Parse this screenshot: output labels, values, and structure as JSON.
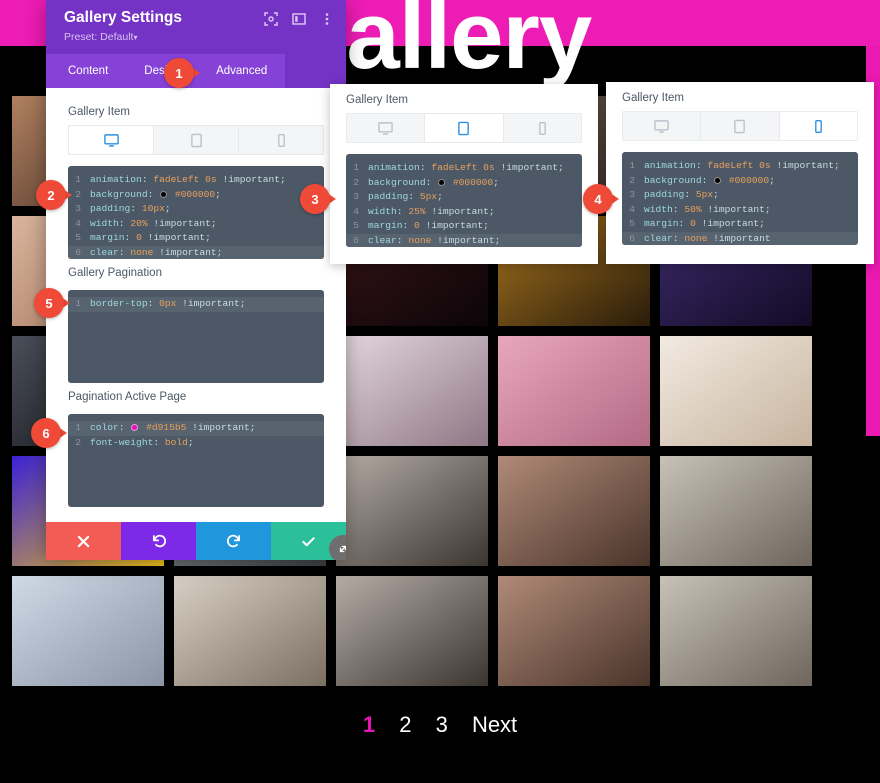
{
  "page": {
    "title": "gallery",
    "header_color": "#ec1cb4",
    "background_color": "#000000",
    "accent_color": "#e614b6"
  },
  "pagination": {
    "pages": [
      "1",
      "2",
      "3"
    ],
    "next_label": "Next",
    "active_page": "1",
    "active_color": "#d915b5"
  },
  "modal": {
    "title": "Gallery Settings",
    "preset_label": "Preset: Default",
    "preset_caret": "▾",
    "header_color": "#7433c5",
    "icons": {
      "focus": "focus-icon",
      "layout": "layout-icon",
      "more": "more-vertical-icon"
    },
    "tabs": [
      {
        "label": "Content",
        "active": false
      },
      {
        "label": "Design",
        "active": false
      },
      {
        "label": "Advanced",
        "active": true
      }
    ],
    "actions": {
      "cancel": "cancel-x",
      "undo": "undo-arrow",
      "redo": "redo-arrow",
      "save": "save-check",
      "cancel_color": "#f25c54",
      "undo_color": "#7c2ae8",
      "redo_color": "#2096dd",
      "save_color": "#2bbf9a"
    }
  },
  "devices": {
    "desktop": "desktop-icon",
    "tablet": "tablet-icon",
    "phone": "phone-icon"
  },
  "sections": {
    "gallery_item_desktop": {
      "label": "Gallery Item",
      "active_device": "desktop",
      "lines": [
        {
          "n": "1",
          "prop": "animation",
          "val": "fadeLeft 0s",
          "imp": "!important;",
          "hl": false
        },
        {
          "n": "2",
          "prop": "background",
          "val": "#000000",
          "swatch": "#000000",
          "imp": ";",
          "hl": false
        },
        {
          "n": "3",
          "prop": "padding",
          "val": "10px",
          "imp": ";",
          "hl": false
        },
        {
          "n": "4",
          "prop": "width",
          "val": "20%",
          "imp": "!important;",
          "hl": false
        },
        {
          "n": "5",
          "prop": "margin",
          "val": "0",
          "imp": "!important;",
          "hl": false
        },
        {
          "n": "6",
          "prop": "clear",
          "val": "none",
          "imp": "!important;",
          "hl": true
        }
      ]
    },
    "gallery_item_tablet": {
      "label": "Gallery Item",
      "active_device": "tablet",
      "lines": [
        {
          "n": "1",
          "prop": "animation",
          "val": "fadeLeft 0s",
          "imp": "!important;",
          "hl": false
        },
        {
          "n": "2",
          "prop": "background",
          "val": "#000000",
          "swatch": "#000000",
          "imp": ";",
          "hl": false
        },
        {
          "n": "3",
          "prop": "padding",
          "val": "5px",
          "imp": ";",
          "hl": false
        },
        {
          "n": "4",
          "prop": "width",
          "val": "25%",
          "imp": "!important;",
          "hl": false
        },
        {
          "n": "5",
          "prop": "margin",
          "val": "0",
          "imp": "!important;",
          "hl": false
        },
        {
          "n": "6",
          "prop": "clear",
          "val": "none",
          "imp": "!important;",
          "hl": true
        }
      ]
    },
    "gallery_item_phone": {
      "label": "Gallery Item",
      "active_device": "phone",
      "lines": [
        {
          "n": "1",
          "prop": "animation",
          "val": "fadeLeft 0s",
          "imp": "!important;",
          "hl": false
        },
        {
          "n": "2",
          "prop": "background",
          "val": "#000000",
          "swatch": "#000000",
          "imp": ";",
          "hl": false
        },
        {
          "n": "3",
          "prop": "padding",
          "val": "5px",
          "imp": ";",
          "hl": false
        },
        {
          "n": "4",
          "prop": "width",
          "val": "50%",
          "imp": "!important;",
          "hl": false
        },
        {
          "n": "5",
          "prop": "margin",
          "val": "0",
          "imp": "!important;",
          "hl": false
        },
        {
          "n": "6",
          "prop": "clear",
          "val": "none",
          "imp": "!important",
          "hl": true
        }
      ]
    },
    "gallery_pagination": {
      "label": "Gallery Pagination",
      "lines": [
        {
          "n": "1",
          "prop": "border-top",
          "val": "0px",
          "imp": "!important;",
          "hl": true
        }
      ]
    },
    "pagination_active_page": {
      "label": "Pagination Active Page",
      "lines": [
        {
          "n": "1",
          "prop": "color",
          "val": "#d915b5",
          "swatch": "#d915b5",
          "imp": "!important;",
          "hl": true
        },
        {
          "n": "2",
          "prop": "font-weight",
          "val": "bold",
          "imp": ";",
          "hl": false
        }
      ]
    }
  },
  "callouts": [
    {
      "n": "1"
    },
    {
      "n": "2"
    },
    {
      "n": "3"
    },
    {
      "n": "4"
    },
    {
      "n": "5"
    },
    {
      "n": "6"
    }
  ],
  "gallery_tiles": [
    [
      {
        "name": "chopsticks-food",
        "c1": "#b08060",
        "c2": "#4a3328"
      },
      {
        "name": "dark-room",
        "c1": "#2b2b33",
        "c2": "#0d0d12"
      },
      {
        "name": "kettlebell-workout",
        "c1": "#8e8f93",
        "c2": "#3a3b40"
      },
      {
        "name": "women-gym-chat",
        "c1": "#6d5a52",
        "c2": "#2e2520"
      },
      {
        "name": "resistance-band",
        "c1": "#8a6a5c",
        "c2": "#33261f"
      }
    ],
    [
      {
        "name": "skin-closeup",
        "c1": "#d9b49c",
        "c2": "#a5775e"
      },
      {
        "name": "shopfront",
        "c1": "#8a8d92",
        "c2": "#33363b"
      },
      {
        "name": "neon-night",
        "c1": "#3a1418",
        "c2": "#0b0508"
      },
      {
        "name": "bar-interior",
        "c1": "#a5731f",
        "c2": "#2a1c0a"
      },
      {
        "name": "concert-singer",
        "c1": "#3d2a6b",
        "c2": "#120b26"
      }
    ],
    [
      {
        "name": "monitor-desk",
        "c1": "#4a4e58",
        "c2": "#14161b"
      },
      {
        "name": "blurred-room",
        "c1": "#6d7075",
        "c2": "#26282c"
      },
      {
        "name": "frosted-cake",
        "c1": "#e4d8de",
        "c2": "#8f7785"
      },
      {
        "name": "piping-pink-frosting",
        "c1": "#e8a7bc",
        "c2": "#b36a85"
      },
      {
        "name": "macarons",
        "c1": "#f2eae1",
        "c2": "#c7b49f"
      }
    ],
    [
      {
        "name": "abstract-blue-yellow",
        "c1": "#3a22d6",
        "c2": "#f5c518"
      },
      {
        "name": "street-view",
        "c1": "#9a9da2",
        "c2": "#3c3f44"
      },
      {
        "name": "gym-squat",
        "c1": "#b5aca6",
        "c2": "#3b3530"
      },
      {
        "name": "brick-wall-fitness",
        "c1": "#b08a78",
        "c2": "#4a342a"
      },
      {
        "name": "runner-outdoor",
        "c1": "#c8c2b6",
        "c2": "#6e665c"
      }
    ],
    [
      {
        "name": "dumplings-plate",
        "c1": "#cfd9e6",
        "c2": "#8a95a6"
      },
      {
        "name": "flowers-bench",
        "c1": "#d8cfc4",
        "c2": "#7b6f62"
      },
      {
        "name": "gym-squat-2",
        "c1": "#b5aca6",
        "c2": "#3b3530"
      },
      {
        "name": "brick-wall-fitness-2",
        "c1": "#b08a78",
        "c2": "#4a342a"
      },
      {
        "name": "runner-outdoor-2",
        "c1": "#c8c2b6",
        "c2": "#6e665c"
      }
    ]
  ]
}
